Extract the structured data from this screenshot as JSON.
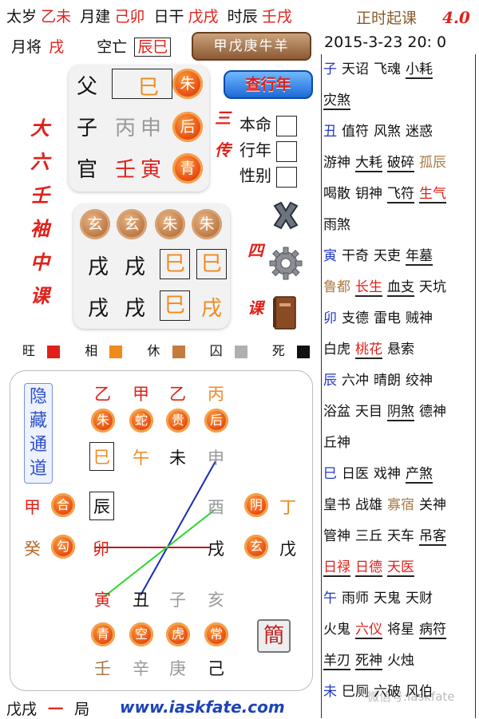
{
  "header": {
    "taisui_label": "太岁",
    "taisui_value": "乙未",
    "yuejian_label": "月建",
    "yuejian_value": "己卯",
    "rigan_label": "日干",
    "rigan_value": "戊戌",
    "shichen_label": "时辰",
    "shichen_value": "壬戌",
    "app_title": "正时起课",
    "version": "4.0",
    "yuejiang_label": "月将",
    "yuejiang_value": "戌",
    "kongwang_label": "空亡",
    "kongwang_value": "辰巳",
    "jiawu_button": "甲戊庚牛羊",
    "datetime": "2015-3-23 20: 0"
  },
  "sanchuan": {
    "rows": [
      {
        "kin": "父",
        "branch_a": "",
        "branch_b": "巳",
        "god": "朱"
      },
      {
        "kin": "子",
        "branch_a": "丙",
        "branch_b": "申",
        "god": "后"
      },
      {
        "kin": "官",
        "branch_a": "壬",
        "branch_b": "寅",
        "god": "青"
      }
    ],
    "label": "三传",
    "query_button": "查行年"
  },
  "options": {
    "benming": "本命",
    "xingnian": "行年",
    "xingbie": "性别"
  },
  "sidebar_title": "大六壬袖中课",
  "sike": {
    "gods": [
      "玄",
      "玄",
      "朱",
      "朱"
    ],
    "row1": [
      "戌",
      "戌",
      "巳",
      "巳"
    ],
    "row2": [
      "戌",
      "戌",
      "巳",
      "戌"
    ],
    "label": "四课"
  },
  "legend": [
    {
      "label": "旺",
      "color": "#e0201a"
    },
    {
      "label": "相",
      "color": "#f08a1c"
    },
    {
      "label": "休",
      "color": "#c47b3e"
    },
    {
      "label": "囚",
      "color": "#b0b0b0"
    },
    {
      "label": "死",
      "color": "#111111"
    }
  ],
  "chart": {
    "hidden_label": "隐藏通道",
    "top_stems": [
      "乙",
      "甲",
      "乙",
      "丙"
    ],
    "top_gods": [
      "朱",
      "蛇",
      "贵",
      "后"
    ],
    "top_branches": [
      "巳",
      "午",
      "未",
      "申"
    ],
    "left_stems": [
      "甲",
      "癸"
    ],
    "left_gods": [
      "合",
      "勾"
    ],
    "left_branches": [
      "辰",
      "卯"
    ],
    "right_branches": [
      "酉",
      "戌"
    ],
    "right_gods": [
      "阴",
      "玄"
    ],
    "right_stems": [
      "丁",
      "戊"
    ],
    "bottom_branches": [
      "寅",
      "丑",
      "子",
      "亥"
    ],
    "bottom_gods": [
      "青",
      "空",
      "虎",
      "常"
    ],
    "bottom_stems": [
      "壬",
      "辛",
      "庚",
      "己"
    ],
    "jian": "簡"
  },
  "footer": {
    "ju_left": "戊戌",
    "ju_num": "一",
    "ju_right": "局",
    "url": "www.iaskfate.com",
    "watermark": "微信号:iaskfate"
  },
  "shensha": [
    {
      "items": [
        {
          "t": "子",
          "c": "blu"
        },
        {
          "t": "天诏",
          "c": "blk"
        },
        {
          "t": "飞魂",
          "c": "blk"
        },
        {
          "t": "小耗",
          "c": "blk",
          "u": true
        }
      ]
    },
    {
      "items": [
        {
          "t": "灾煞",
          "c": "blk",
          "u": true
        }
      ]
    },
    {
      "items": [
        {
          "t": "丑",
          "c": "blu"
        },
        {
          "t": "值符",
          "c": "blk"
        },
        {
          "t": "风煞",
          "c": "blk"
        },
        {
          "t": "迷惑",
          "c": "blk"
        }
      ]
    },
    {
      "items": [
        {
          "t": "游神",
          "c": "blk"
        },
        {
          "t": "大耗",
          "c": "blk",
          "u": true
        },
        {
          "t": "破碎",
          "c": "blk",
          "u": true
        },
        {
          "t": "孤辰",
          "c": "tan"
        }
      ]
    },
    {
      "items": [
        {
          "t": "喝散",
          "c": "blk"
        },
        {
          "t": "钥神",
          "c": "blk"
        },
        {
          "t": "飞符",
          "c": "blk",
          "u": true
        },
        {
          "t": "生气",
          "c": "red",
          "u": true
        }
      ]
    },
    {
      "items": [
        {
          "t": "雨煞",
          "c": "blk"
        }
      ]
    },
    {
      "items": [
        {
          "t": "寅",
          "c": "blu"
        },
        {
          "t": "干奇",
          "c": "blk"
        },
        {
          "t": "天吏",
          "c": "blk"
        },
        {
          "t": "年墓",
          "c": "blk",
          "u": true
        }
      ]
    },
    {
      "items": [
        {
          "t": "鲁都",
          "c": "tan"
        },
        {
          "t": "长生",
          "c": "red",
          "u": true
        },
        {
          "t": "血支",
          "c": "blk",
          "u": true
        },
        {
          "t": "天坑",
          "c": "blk"
        }
      ]
    },
    {
      "items": [
        {
          "t": "卯",
          "c": "blu"
        },
        {
          "t": "支德",
          "c": "blk"
        },
        {
          "t": "雷电",
          "c": "blk"
        },
        {
          "t": "贼神",
          "c": "blk"
        }
      ]
    },
    {
      "items": [
        {
          "t": "白虎",
          "c": "blk"
        },
        {
          "t": "桃花",
          "c": "red",
          "u": true
        },
        {
          "t": "悬索",
          "c": "blk"
        }
      ]
    },
    {
      "items": [
        {
          "t": "辰",
          "c": "blu"
        },
        {
          "t": "六冲",
          "c": "blk"
        },
        {
          "t": "晴朗",
          "c": "blk"
        },
        {
          "t": "绞神",
          "c": "blk"
        }
      ]
    },
    {
      "items": [
        {
          "t": "浴盆",
          "c": "blk"
        },
        {
          "t": "天目",
          "c": "blk"
        },
        {
          "t": "阴煞",
          "c": "blk",
          "u": true
        },
        {
          "t": "德神",
          "c": "blk"
        }
      ]
    },
    {
      "items": [
        {
          "t": "丘神",
          "c": "blk"
        }
      ]
    },
    {
      "items": [
        {
          "t": "巳",
          "c": "blu"
        },
        {
          "t": "日医",
          "c": "blk"
        },
        {
          "t": "戏神",
          "c": "blk"
        },
        {
          "t": "产煞",
          "c": "blk",
          "u": true
        }
      ]
    },
    {
      "items": [
        {
          "t": "皇书",
          "c": "blk"
        },
        {
          "t": "战雄",
          "c": "blk"
        },
        {
          "t": "寡宿",
          "c": "tan"
        },
        {
          "t": "关神",
          "c": "blk"
        }
      ]
    },
    {
      "items": [
        {
          "t": "管神",
          "c": "blk"
        },
        {
          "t": "三丘",
          "c": "blk"
        },
        {
          "t": "天车",
          "c": "blk"
        },
        {
          "t": "吊客",
          "c": "blk",
          "u": true
        }
      ]
    },
    {
      "items": [
        {
          "t": "日禄",
          "c": "red",
          "u": true
        },
        {
          "t": "日德",
          "c": "red",
          "u": true
        },
        {
          "t": "天医",
          "c": "red",
          "u": true
        }
      ]
    },
    {
      "items": [
        {
          "t": "午",
          "c": "blu"
        },
        {
          "t": "雨师",
          "c": "blk"
        },
        {
          "t": "天鬼",
          "c": "blk"
        },
        {
          "t": "天财",
          "c": "blk"
        }
      ]
    },
    {
      "items": [
        {
          "t": "火鬼",
          "c": "blk"
        },
        {
          "t": "六仪",
          "c": "red",
          "u": true
        },
        {
          "t": "将星",
          "c": "blk"
        },
        {
          "t": "病符",
          "c": "blk",
          "u": true
        }
      ]
    },
    {
      "items": [
        {
          "t": "羊刃",
          "c": "blk",
          "u": true
        },
        {
          "t": "死神",
          "c": "blk",
          "u": true
        },
        {
          "t": "火烛",
          "c": "blk"
        }
      ]
    },
    {
      "items": [
        {
          "t": "未",
          "c": "blu"
        },
        {
          "t": "巳厕",
          "c": "blk"
        },
        {
          "t": "六破",
          "c": "blk"
        },
        {
          "t": "风伯",
          "c": "blk"
        }
      ]
    }
  ]
}
